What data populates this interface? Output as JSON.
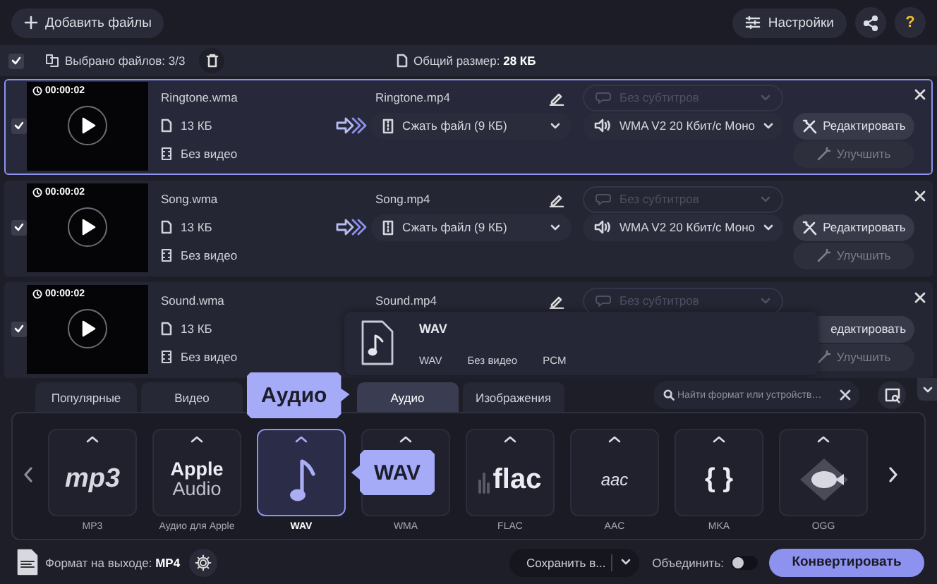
{
  "toolbar": {
    "add_button": "Добавить файлы",
    "settings_button": "Настройки",
    "help_button": "?"
  },
  "selection_bar": {
    "checked": true,
    "selected_count": "Выбрано файлов: 3/3",
    "total_size": "Общий размер: **28 КБ**"
  },
  "files": [
    {
      "selected": true,
      "checked": true,
      "duration": "00:00:02",
      "name": "Ringtone.wma",
      "size": "13 КБ",
      "video": "Без видео",
      "output_name": "Ringtone.mp4",
      "subtitles": "Без субтитров",
      "compress": "Сжать файл (9 КБ)",
      "audio": "WMA V2 20 Кбит/с Моно",
      "edit_button": "Редактировать",
      "enhance_button": "Улучшить"
    },
    {
      "selected": false,
      "checked": true,
      "duration": "00:00:02",
      "name": "Song.wma",
      "size": "13 КБ",
      "video": "Без видео",
      "output_name": "Song.mp4",
      "subtitles": "Без субтитров",
      "compress": "Сжать файл (9 КБ)",
      "audio": "WMA V2 20 Кбит/с Моно",
      "edit_button": "Редактировать",
      "enhance_button": "Улучшить"
    },
    {
      "selected": false,
      "checked": true,
      "duration": "00:00:02",
      "name": "Sound.wma",
      "size": "13 КБ",
      "video": "Без видео",
      "output_name": "Sound.mp4",
      "subtitles": "Без субтитров",
      "edit_button": "едактировать",
      "enhance_button": "Улучшить"
    }
  ],
  "format_popup": {
    "title": "WAV",
    "format": "WAV",
    "video": "Без видео",
    "codec": "PCM"
  },
  "format_tabs": [
    {
      "label": "Популярные",
      "selected": false
    },
    {
      "label": "Видео",
      "selected": false
    },
    {
      "label": "Аудио",
      "selected": true
    },
    {
      "label": "Изображения",
      "selected": false
    }
  ],
  "tab_tooltip": "Аудио",
  "search": {
    "placeholder": "Найти формат или устройств…"
  },
  "formats": [
    {
      "label": "MP3",
      "kind": "mp3",
      "logo": [
        "mp3"
      ],
      "selected": false
    },
    {
      "label": "Аудио для Apple",
      "kind": "apple",
      "logo": [
        "Apple",
        "Audio"
      ],
      "selected": false
    },
    {
      "label": "WAV",
      "kind": "note",
      "selected": true
    },
    {
      "label": "WMA",
      "kind": "covered",
      "selected": false
    },
    {
      "label": "FLAC",
      "kind": "flac",
      "logo": [
        "flac"
      ],
      "selected": false
    },
    {
      "label": "AAC",
      "kind": "aac",
      "logo": [
        "aac"
      ],
      "selected": false
    },
    {
      "label": "MKA",
      "kind": "braces",
      "logo": [
        "{ }"
      ],
      "selected": false
    },
    {
      "label": "OGG",
      "kind": "fish",
      "selected": false
    }
  ],
  "format_tooltip": "WAV",
  "bottom_bar": {
    "output_format": "Формат на выходе: **MP4**",
    "save_to": "Сохранить в...",
    "merge_label": "Объединить:",
    "merge_on": false,
    "convert_button": "Конвертировать"
  }
}
